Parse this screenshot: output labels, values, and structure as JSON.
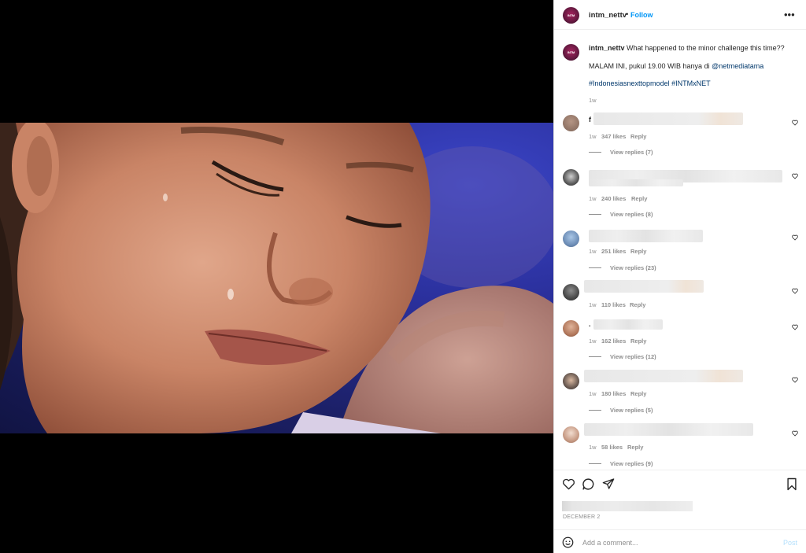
{
  "post": {
    "username": "intm_nettv",
    "separator": "•",
    "follow_label": "Follow",
    "more_label": "•••",
    "avatar_text": "INTM"
  },
  "caption": {
    "username": "intm_nettv",
    "text": "What happened to the minor challenge this time??",
    "line2_prefix": "MALAM INI, pukul 19.00 WIB hanya di ",
    "line2_mention": "@netmediatama",
    "hashtags": "#Indonesiasnexttopmodel #INTMxNET",
    "time": "1w"
  },
  "comments": [
    {
      "initial": "f",
      "time": "1w",
      "likes": "347 likes",
      "reply": "Reply",
      "view_replies": "View replies (7)"
    },
    {
      "initial": "",
      "time": "1w",
      "likes": "240 likes",
      "reply": "Reply",
      "view_replies": "View replies (8)"
    },
    {
      "initial": "",
      "time": "1w",
      "likes": "251 likes",
      "reply": "Reply",
      "view_replies": "View replies (23)"
    },
    {
      "initial": "",
      "time": "1w",
      "likes": "110 likes",
      "reply": "Reply",
      "view_replies": ""
    },
    {
      "initial": ".",
      "time": "1w",
      "likes": "162 likes",
      "reply": "Reply",
      "view_replies": "View replies (12)"
    },
    {
      "initial": "",
      "time": "1w",
      "likes": "180 likes",
      "reply": "Reply",
      "view_replies": "View replies (5)"
    },
    {
      "initial": "",
      "time": "1w",
      "likes": "58 likes",
      "reply": "Reply",
      "view_replies": "View replies (9)"
    }
  ],
  "footer": {
    "date": "DECEMBER 2",
    "add_comment_placeholder": "Add a comment...",
    "post_label": "Post"
  },
  "icons": {
    "like": "heart-icon",
    "comment": "comment-icon",
    "share": "share-icon",
    "save": "bookmark-icon",
    "emoji": "emoji-icon",
    "audio": "speaker-icon"
  },
  "colors": {
    "follow": "#0095f6",
    "link": "#00376b",
    "secondary_text": "#8e8e8e",
    "post_disabled": "#b2dffc"
  }
}
